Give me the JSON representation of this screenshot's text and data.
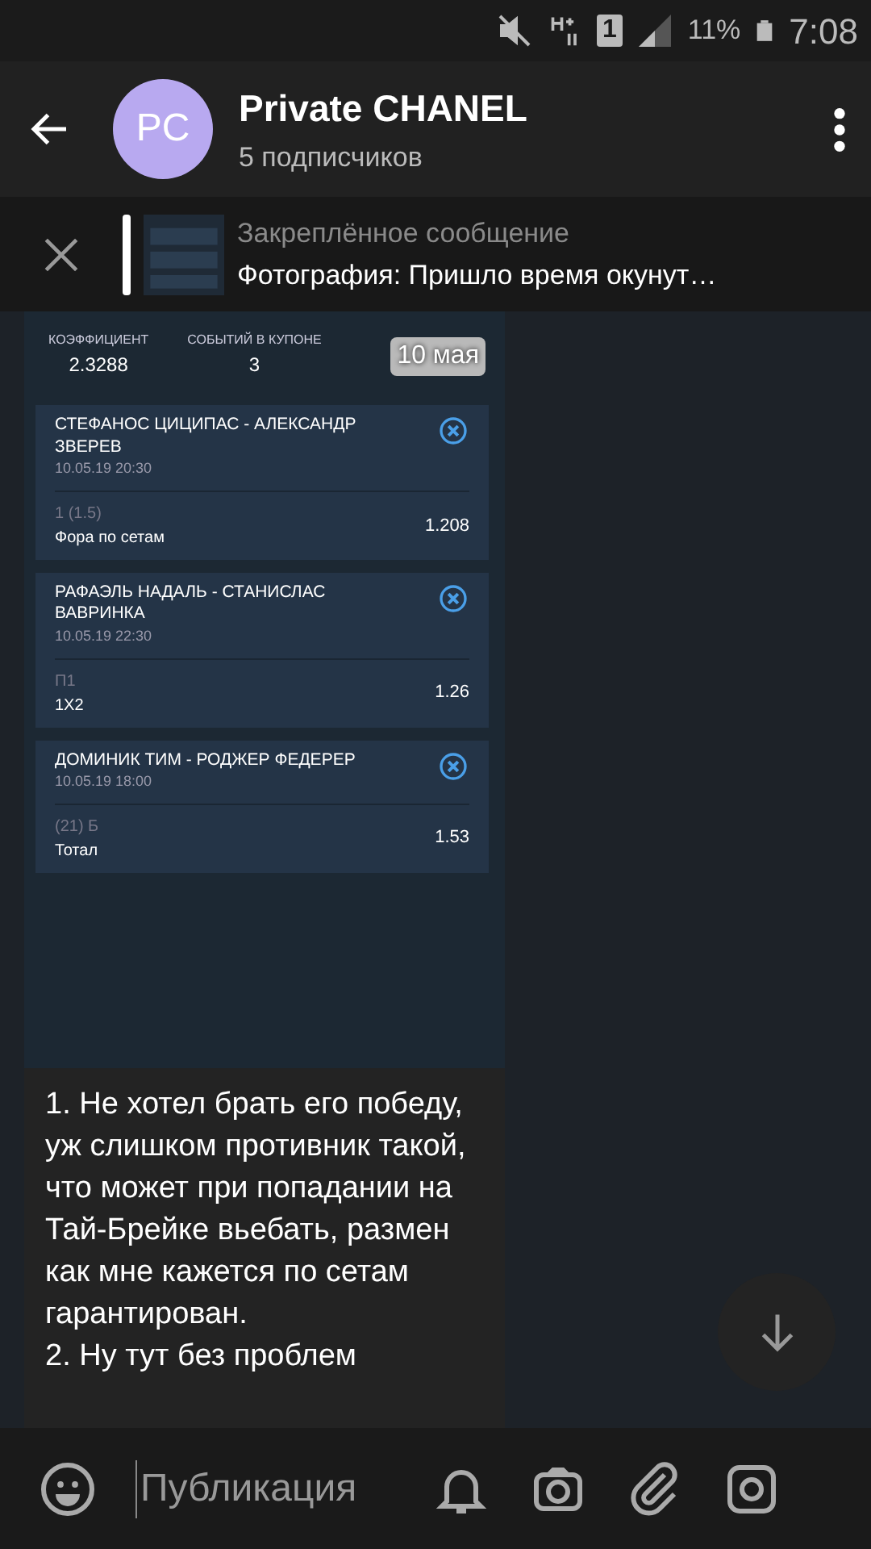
{
  "status_bar": {
    "battery": "11%",
    "time": "7:08",
    "sim": "1"
  },
  "header": {
    "avatar": "PC",
    "title": "Private CHANEL",
    "subtitle": "5 подписчиков"
  },
  "pinned": {
    "label": "Закреплённое сообщение",
    "text": "Фотография: Пришло время окунут…"
  },
  "coupon": {
    "stats": [
      {
        "label": "КОЭФФИЦИЕНТ",
        "value": "2.3288"
      },
      {
        "label": "СОБЫТИЙ В КУПОНЕ",
        "value": "3"
      }
    ],
    "date_pill": "10 мая",
    "events": [
      {
        "title": "СТЕФАНОС ЦИЦИПАС - АЛЕКСАНДР ЗВЕРЕВ",
        "time": "10.05.19 20:30",
        "outcome": "1 (1.5)",
        "market": "Фора по сетам",
        "odds": "1.208"
      },
      {
        "title": "РАФАЭЛЬ НАДАЛЬ - СТАНИСЛАС ВАВРИНКА",
        "time": "10.05.19 22:30",
        "outcome": "П1",
        "market": "1Х2",
        "odds": "1.26"
      },
      {
        "title": "ДОМИНИК ТИМ - РОДЖЕР ФЕДЕРЕР",
        "time": "10.05.19 18:00",
        "outcome": "(21) Б",
        "market": "Тотал",
        "odds": "1.53"
      }
    ]
  },
  "message": {
    "lines": [
      "1. Не хотел брать его победу, уж слишком противник такой, что может при попадании на Тай-Брейке вьебать, размен как мне кажется по сетам гарантирован.",
      "2. Ну тут без проблем"
    ]
  },
  "composer": {
    "placeholder": "Публикация"
  }
}
